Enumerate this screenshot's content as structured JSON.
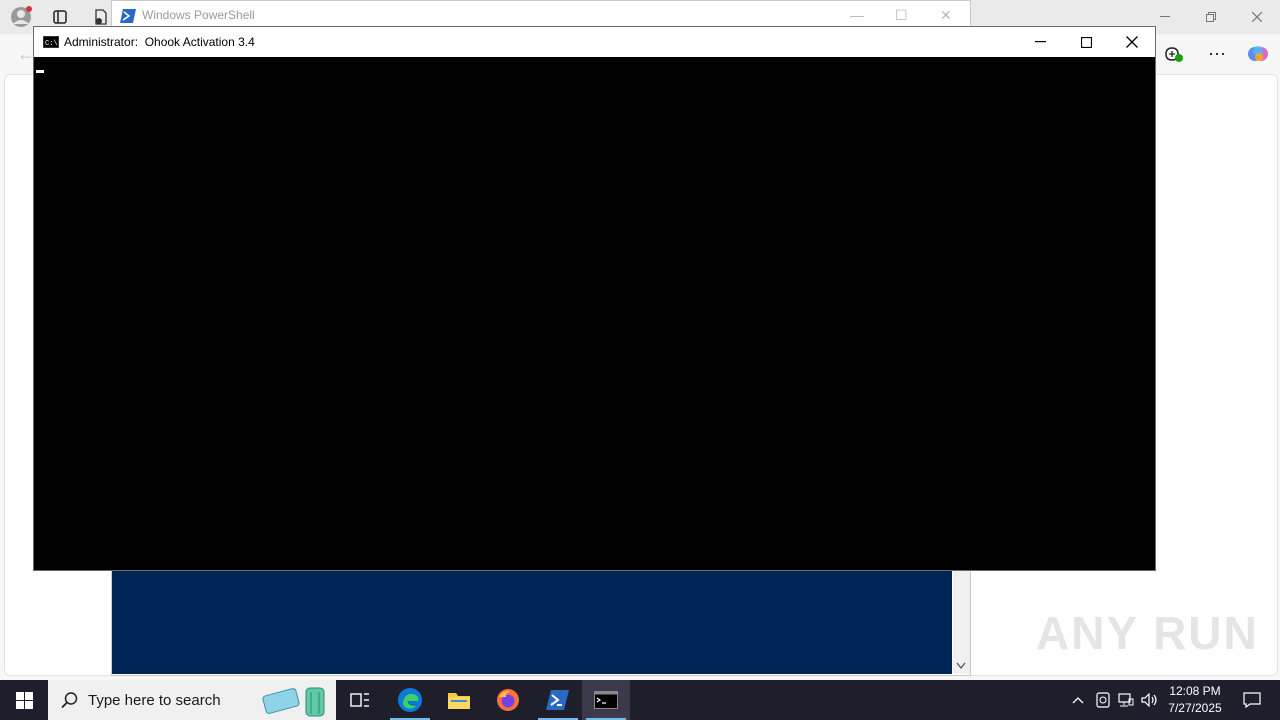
{
  "edge": {
    "colors": {
      "copilot": "#5b8def"
    }
  },
  "powershell": {
    "title": "Windows PowerShell",
    "bg_color": "#012456"
  },
  "console": {
    "title_prefix": "Administrator:",
    "title_name": "Ohook Activation 3.4"
  },
  "taskbar": {
    "search_placeholder": "Type here to search",
    "time": "12:08 PM",
    "date": "7/27/2025",
    "apps": [
      "task-view-icon",
      "edge-icon",
      "file-explorer-icon",
      "firefox-icon",
      "powershell-icon",
      "cmd-icon"
    ]
  },
  "watermark": "ANY RUN"
}
